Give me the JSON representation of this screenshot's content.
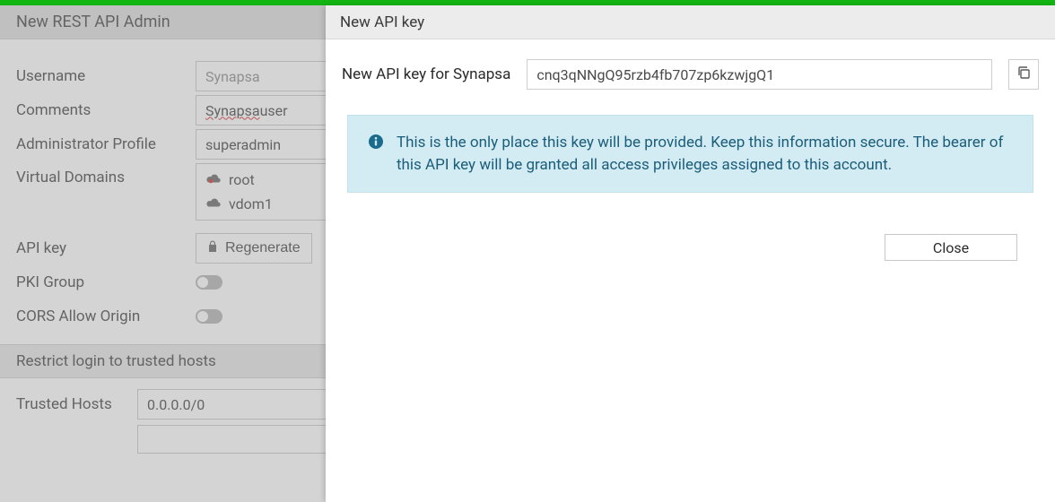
{
  "left": {
    "title": "New REST API Admin",
    "fields": {
      "username_label": "Username",
      "username_value": "Synapsa",
      "comments_label": "Comments",
      "comments_value_pre": "Synapsa",
      "comments_value_post": " user",
      "admin_profile_label": "Administrator Profile",
      "admin_profile_value": "superadmin",
      "vdom_label": "Virtual Domains",
      "vdom_items": [
        "root",
        "vdom1"
      ],
      "api_key_label": "API key",
      "regenerate_label": "Regenerate",
      "pki_label": "PKI Group",
      "cors_label": "CORS Allow Origin"
    },
    "restrict": {
      "header": "Restrict login to trusted hosts",
      "hosts_label": "Trusted Hosts",
      "host_value": "0.0.0.0/0"
    }
  },
  "modal": {
    "title": "New API key",
    "key_label": "New API key for Synapsa",
    "key_value": "cnq3qNNgQ95rzb4fb707zp6kzwjgQ1",
    "info_text": "This is the only place this key will be provided. Keep this information secure. The bearer of this API key will be granted all access privileges assigned to this account.",
    "close_label": "Close"
  }
}
